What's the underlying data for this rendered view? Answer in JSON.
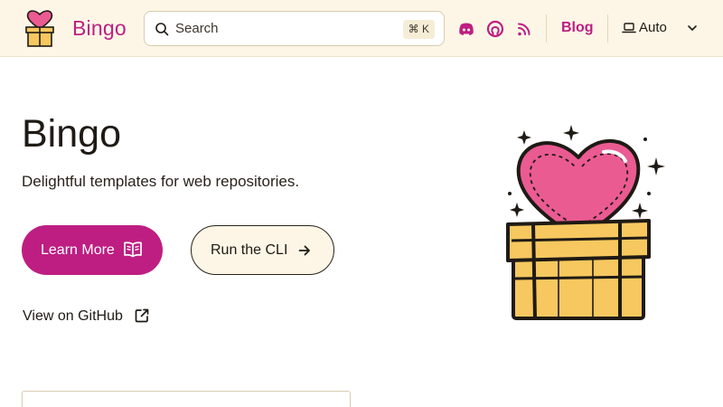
{
  "header": {
    "brand": "Bingo",
    "search": {
      "placeholder": "Search",
      "shortcut": "⌘ K"
    },
    "icons": [
      "discord-icon",
      "github-icon",
      "rss-icon"
    ],
    "blog_label": "Blog",
    "theme": {
      "selected": "Auto"
    }
  },
  "hero": {
    "title": "Bingo",
    "tagline": "Delightful templates for web repositories.",
    "primary_button": "Learn More",
    "secondary_button": "Run the CLI",
    "github_link": "View on GitHub"
  },
  "colors": {
    "accent": "#be1e82",
    "header_bg": "#fdf6e6",
    "heart": "#ea5b92",
    "box": "#f7c85f",
    "text": "#1f1a14"
  }
}
